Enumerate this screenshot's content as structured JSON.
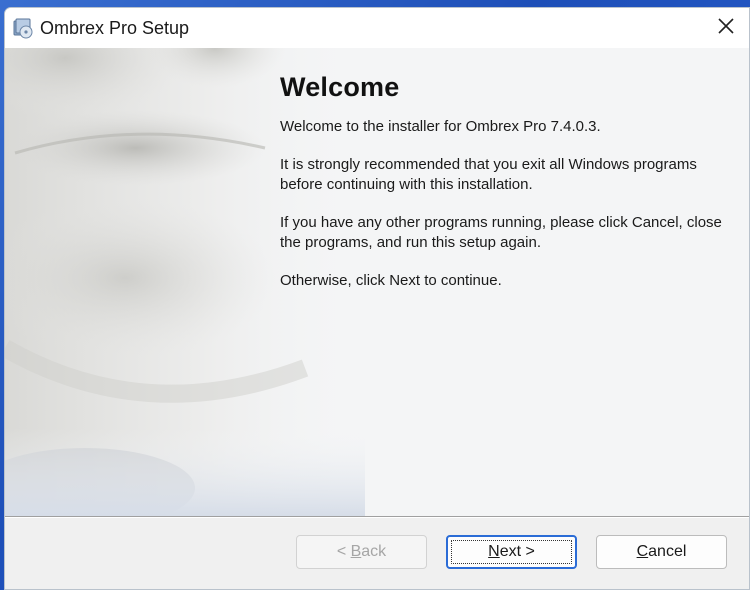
{
  "window": {
    "title": "Ombrex Pro Setup"
  },
  "welcome": {
    "heading": "Welcome",
    "paragraphs": [
      "Welcome to the installer for Ombrex Pro 7.4.0.3.",
      "It is strongly recommended that you exit all Windows programs before continuing with this installation.",
      "If you have any other programs running, please click Cancel, close the programs, and run this setup again.",
      "Otherwise, click Next to continue."
    ]
  },
  "buttons": {
    "back": {
      "pre": "< ",
      "accel": "B",
      "post": "ack",
      "enabled": false
    },
    "next": {
      "accel": "N",
      "post": "ext >",
      "default": true
    },
    "cancel": {
      "accel": "C",
      "post": "ancel"
    }
  },
  "colors": {
    "accent": "#2b6cd6",
    "content_bg": "#f4f5f6",
    "footer_bg": "#f0f0f0"
  },
  "icons": {
    "app": "installer-cd-icon",
    "close": "close-icon"
  }
}
